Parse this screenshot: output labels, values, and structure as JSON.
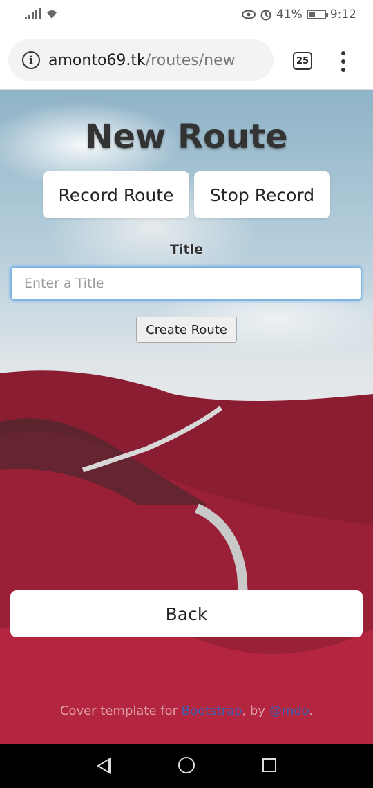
{
  "status_bar": {
    "battery": "41%",
    "time": "9:12",
    "icons": [
      "signal-icon",
      "wifi-icon",
      "eye-icon",
      "alarm-icon",
      "battery-icon"
    ]
  },
  "browser": {
    "url_host": "amonto69.tk",
    "url_path": "/routes/new",
    "tab_count": "25"
  },
  "page": {
    "title": "New Route",
    "record_button": "Record Route",
    "stop_button": "Stop Record",
    "title_label": "Title",
    "title_input_placeholder": "Enter a Title",
    "title_input_value": "",
    "create_button": "Create Route",
    "back_button": "Back"
  },
  "footer": {
    "prefix": "Cover template for ",
    "link1": "Bootstrap",
    "middle": ", by ",
    "link2": "@mdo",
    "suffix": "."
  },
  "colors": {
    "input_focus_border": "#80b3e6",
    "link": "#3f5fb0"
  }
}
